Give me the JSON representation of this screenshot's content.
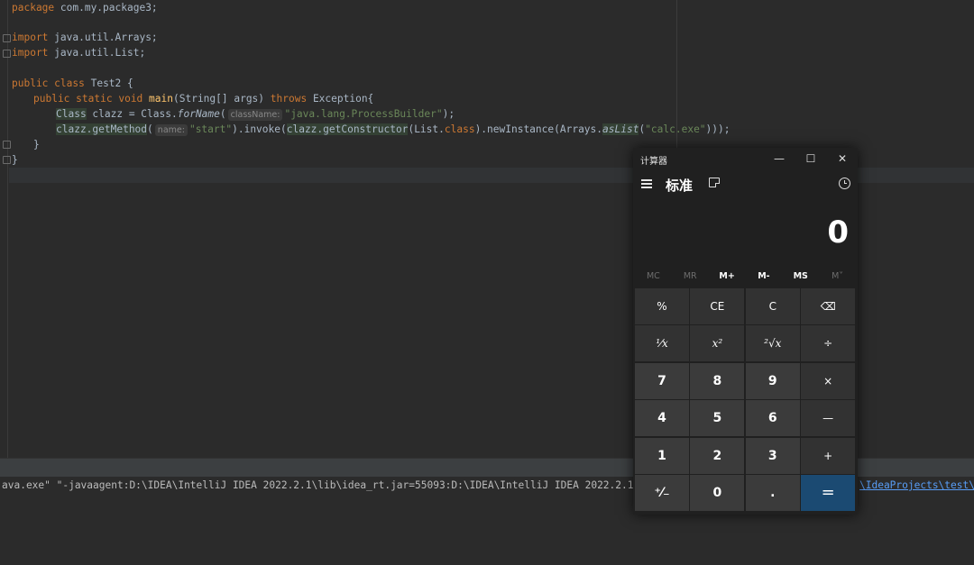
{
  "editor": {
    "lines": {
      "l1": {
        "kw": "package",
        "text": " com.my.package3;"
      },
      "l3": {
        "kw": "import",
        "text": " java.util.Arrays;"
      },
      "l4": {
        "kw": "import",
        "text": " java.util.List;"
      },
      "l6": {
        "kw1": "public",
        "kw2": "class",
        "name": " Test2 {"
      },
      "l7": {
        "kw1": "public",
        "kw2": "static",
        "kw3": "void",
        "method": "main",
        "params": "(String[] args) ",
        "throws": "throws",
        "exc": " Exception{"
      },
      "l8": {
        "type": "Class",
        "mid": " clazz = Class.",
        "fn": "forName",
        "open": "(",
        "hint": "className:",
        "str": "\"java.lang.ProcessBuilder\"",
        "close": ");"
      },
      "l9": {
        "a": "clazz.getMethod",
        "open": "(",
        "hint": "name:",
        "str": "\"start\"",
        "b": ").invoke(",
        "c": "clazz.getConstructor",
        "d": "(List.",
        "cls": "class",
        "e": ").newInstance(Arrays.",
        "f": "asList",
        "g": "(",
        "str2": "\"calc.exe\"",
        "h": ")));"
      },
      "l10": {
        "text": "}"
      },
      "l11": {
        "text": "}"
      }
    }
  },
  "console": {
    "text": "ava.exe\" \"-javaagent:D:\\IDEA\\IntelliJ IDEA 2022.2.1\\lib\\idea_rt.jar=55093:D:\\IDEA\\IntelliJ IDEA 2022.2.1\\bin\" -Dfi",
    "link": "\\IdeaProjects\\test\\ou"
  },
  "calculator": {
    "title": "计算器",
    "window_buttons": {
      "minimize": "—",
      "maximize": "☐",
      "close": "✕"
    },
    "mode": "标准",
    "display": "0",
    "memory": [
      {
        "label": "MC",
        "enabled": false
      },
      {
        "label": "MR",
        "enabled": false
      },
      {
        "label": "M+",
        "enabled": true
      },
      {
        "label": "M-",
        "enabled": true
      },
      {
        "label": "MS",
        "enabled": true
      },
      {
        "label": "M˅",
        "enabled": false
      }
    ],
    "keys": [
      {
        "label": "%",
        "kind": "op",
        "name": "percent-button"
      },
      {
        "label": "CE",
        "kind": "op",
        "name": "clear-entry-button"
      },
      {
        "label": "C",
        "kind": "op",
        "name": "clear-button"
      },
      {
        "label": "⌫",
        "kind": "op",
        "name": "backspace-button"
      },
      {
        "label": "¹⁄x",
        "kind": "op",
        "name": "reciprocal-button"
      },
      {
        "label": "x²",
        "kind": "op",
        "name": "square-button"
      },
      {
        "label": "²√x",
        "kind": "op",
        "name": "sqrt-button"
      },
      {
        "label": "÷",
        "kind": "op",
        "name": "divide-button"
      },
      {
        "label": "7",
        "kind": "num",
        "name": "digit-7-button"
      },
      {
        "label": "8",
        "kind": "num",
        "name": "digit-8-button"
      },
      {
        "label": "9",
        "kind": "num",
        "name": "digit-9-button"
      },
      {
        "label": "×",
        "kind": "op",
        "name": "multiply-button"
      },
      {
        "label": "4",
        "kind": "num",
        "name": "digit-4-button"
      },
      {
        "label": "5",
        "kind": "num",
        "name": "digit-5-button"
      },
      {
        "label": "6",
        "kind": "num",
        "name": "digit-6-button"
      },
      {
        "label": "—",
        "kind": "op",
        "name": "subtract-button"
      },
      {
        "label": "1",
        "kind": "num",
        "name": "digit-1-button"
      },
      {
        "label": "2",
        "kind": "num",
        "name": "digit-2-button"
      },
      {
        "label": "3",
        "kind": "num",
        "name": "digit-3-button"
      },
      {
        "label": "+",
        "kind": "op",
        "name": "add-button"
      },
      {
        "label": "⁺⁄₋",
        "kind": "num",
        "name": "negate-button"
      },
      {
        "label": "0",
        "kind": "num",
        "name": "digit-0-button"
      },
      {
        "label": ".",
        "kind": "num",
        "name": "decimal-button"
      },
      {
        "label": "=",
        "kind": "eq",
        "name": "equals-button"
      }
    ]
  },
  "colors": {
    "accent": "#1b4a72",
    "editor_bg": "#2b2b2b",
    "keyword": "#cc7832",
    "string": "#6a8759"
  }
}
